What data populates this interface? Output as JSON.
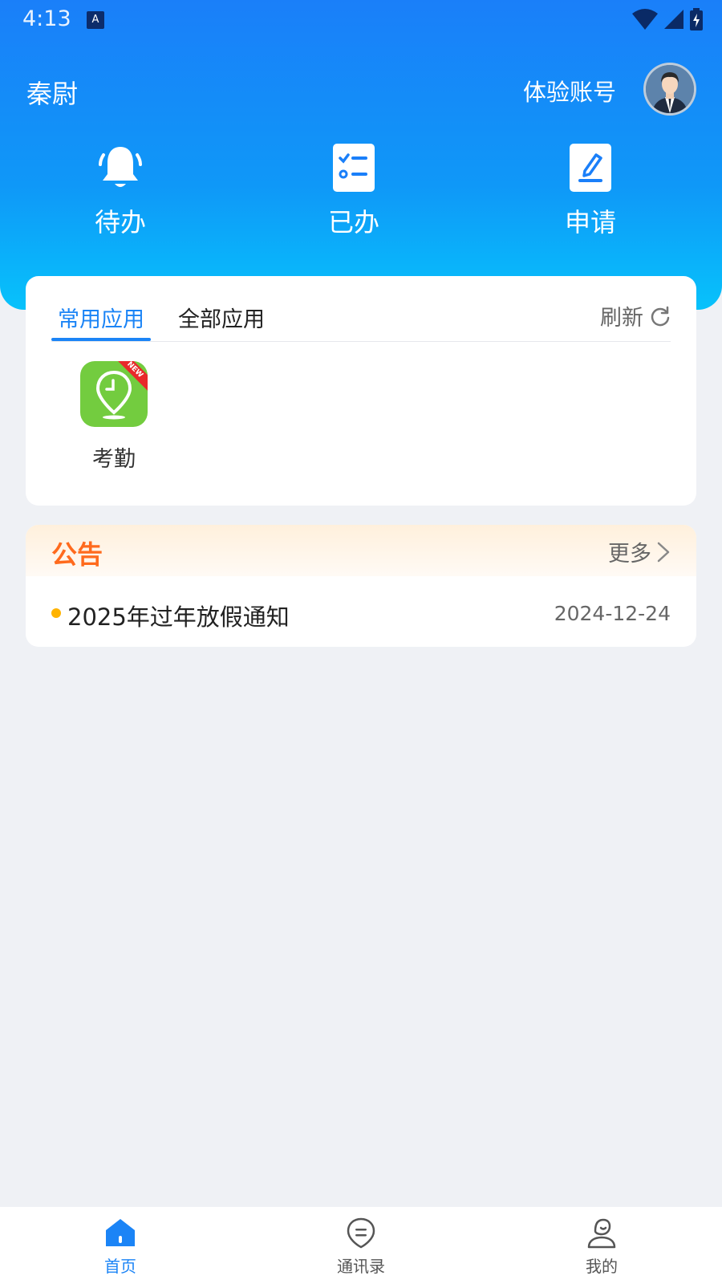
{
  "status_bar": {
    "time": "4:13",
    "notification_badge": "A"
  },
  "header": {
    "company": "秦尉",
    "account_label": "体验账号"
  },
  "quick_actions": [
    {
      "label": "待办",
      "icon": "bell-icon"
    },
    {
      "label": "已办",
      "icon": "checklist-icon"
    },
    {
      "label": "申请",
      "icon": "edit-document-icon"
    }
  ],
  "apps": {
    "tabs": [
      {
        "label": "常用应用",
        "active": true
      },
      {
        "label": "全部应用",
        "active": false
      }
    ],
    "refresh_label": "刷新",
    "items": [
      {
        "label": "考勤",
        "icon": "location-clock-icon",
        "badge": "NEW"
      }
    ]
  },
  "notice": {
    "title": "公告",
    "more_label": "更多",
    "items": [
      {
        "title": "2025年过年放假通知",
        "date": "2024-12-24"
      }
    ]
  },
  "bottom_nav": [
    {
      "label": "首页",
      "icon": "home-icon",
      "active": true
    },
    {
      "label": "通讯录",
      "icon": "contacts-icon",
      "active": false
    },
    {
      "label": "我的",
      "icon": "profile-icon",
      "active": false
    }
  ],
  "colors": {
    "primary": "#1b84f6",
    "notice_title": "#ff6a1d",
    "app_green": "#73cc3f",
    "dot": "#ffb300"
  }
}
